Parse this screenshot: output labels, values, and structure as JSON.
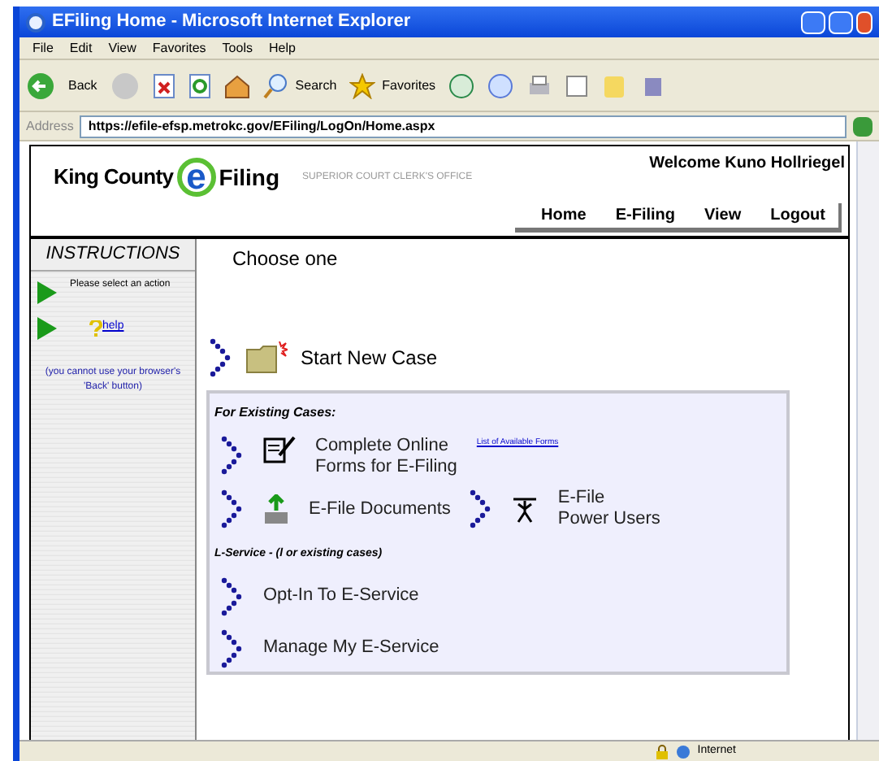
{
  "window": {
    "title": "EFiling Home - Microsoft Internet Explorer"
  },
  "menu": [
    "File",
    "Edit",
    "View",
    "Favorites",
    "Tools",
    "Help"
  ],
  "toolbar": {
    "back": "Back",
    "search": "Search",
    "favorites": "Favorites"
  },
  "address": {
    "label": "Address",
    "url": "https://efile-efsp.metrokc.gov/EFiling/LogOn/Home.aspx"
  },
  "header": {
    "logo_left": "King County",
    "logo_letter": "e",
    "logo_right": "Filing",
    "subtitle": "SUPERIOR COURT CLERK'S OFFICE",
    "welcome": "Welcome Kuno Hollriegel",
    "nav": [
      "Home",
      "E-Filing",
      "View",
      "Logout"
    ]
  },
  "sidebar": {
    "title": "INSTRUCTIONS",
    "instruction": "Please select an action",
    "help": "help",
    "note": "(you cannot use your browser's 'Back' button)"
  },
  "main": {
    "heading": "Choose one",
    "start": "Start New Case",
    "existing": {
      "title": "For Existing Cases:",
      "forms": [
        "Complete Online",
        "Forms for E-Filing"
      ],
      "forms_link": "List of Available Forms",
      "documents": "E-File Documents",
      "power": [
        "E-File",
        "Power Users"
      ]
    },
    "service": {
      "title": "L-Service - (l or existing cases)",
      "items": [
        "Opt-In To E-Service",
        "Manage My E-Service"
      ]
    }
  },
  "status_bar": {
    "zone": "Internet"
  }
}
